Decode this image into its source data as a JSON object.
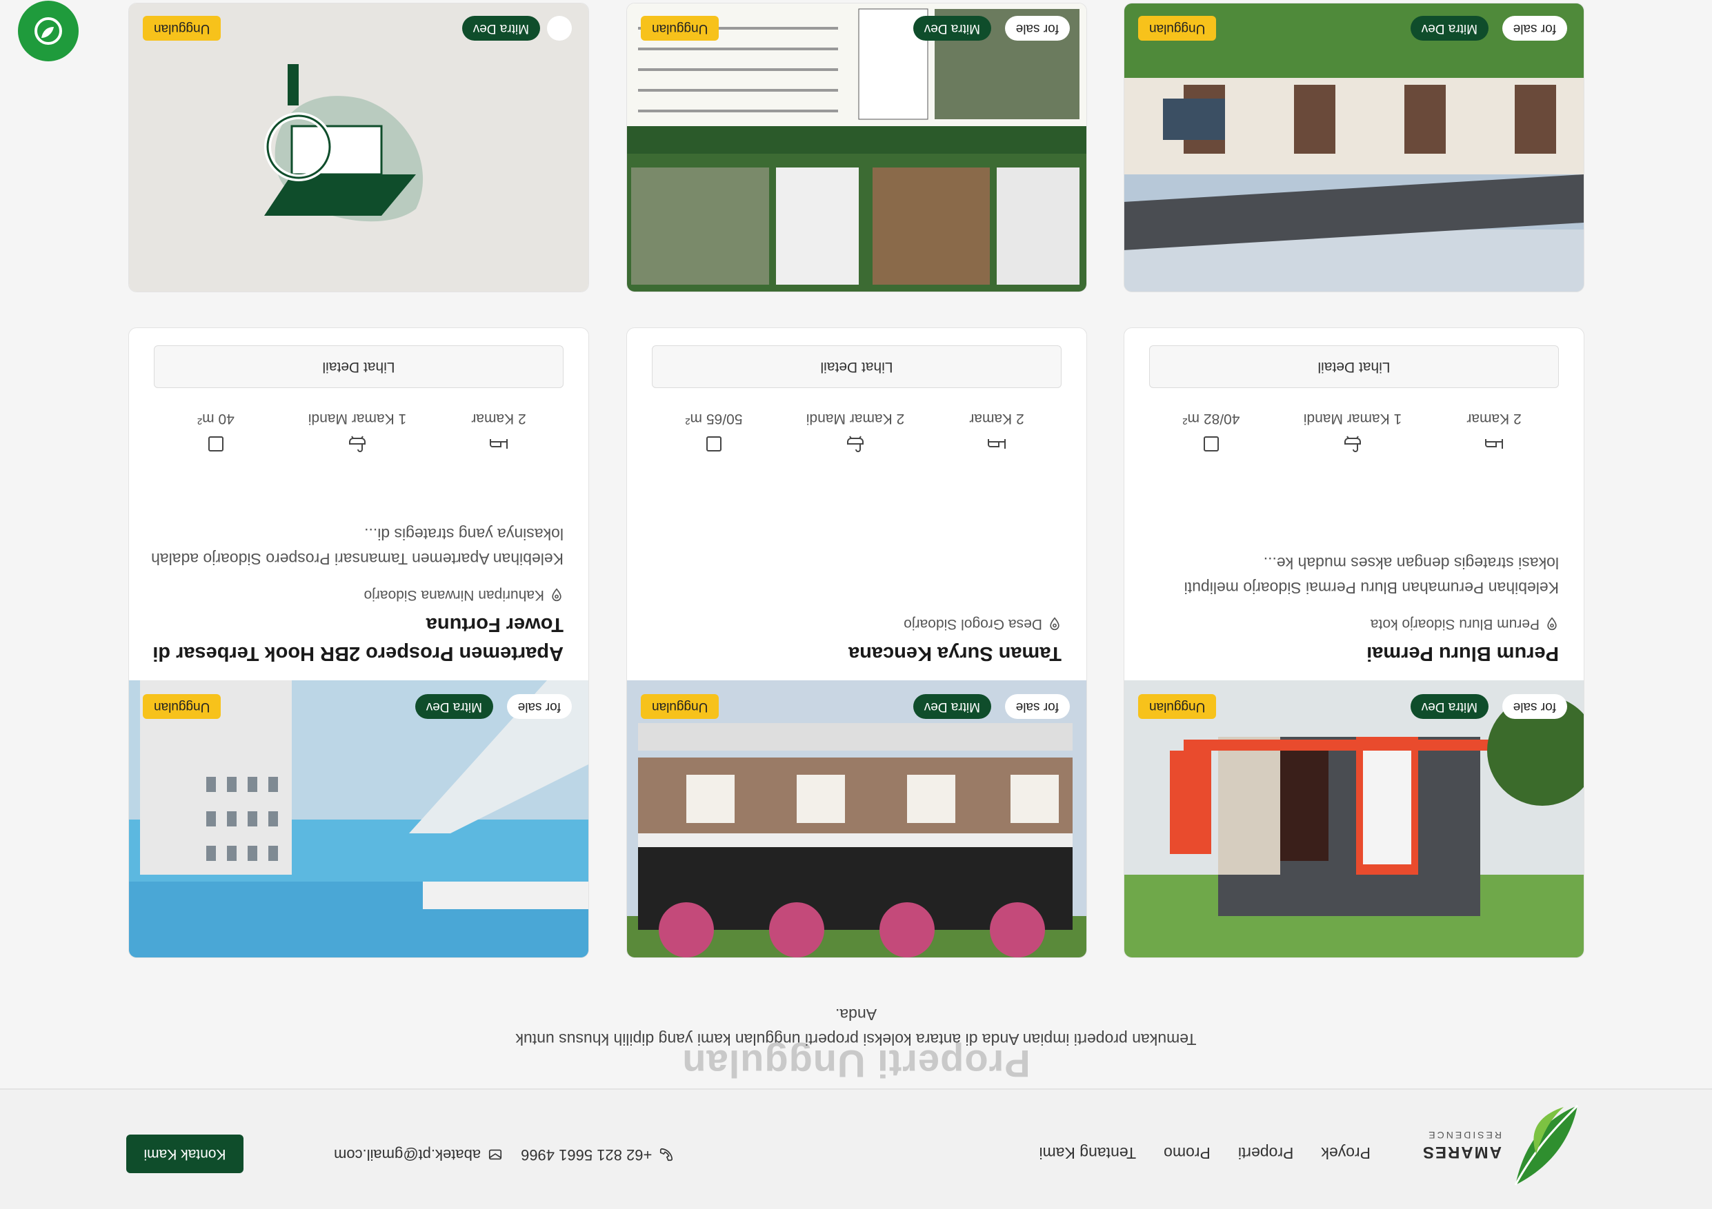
{
  "header": {
    "logo_name": "AMARES",
    "logo_sub": "RESIDENCE",
    "nav": [
      "Proyek",
      "Properti",
      "Promo",
      "Tentang Kami"
    ],
    "phone": "+62 821 5661 4966",
    "email": "abatek.pt@gmail.com",
    "contact_button": "Kontak Kami"
  },
  "section": {
    "title": "Properti Unggulan",
    "subtitle": "Temukan properti impian Anda di antara koleksi properti unggulan kami yang dipilih khusus untuk Anda."
  },
  "badges": {
    "sale": "for sale",
    "mitra": "Mitra Dev",
    "unggulan": "Unggulan"
  },
  "cards": [
    {
      "title": "Perum Bluru Permai",
      "location": "Perum Bluru Sidoarjo kota",
      "description": "Kelebihan Perumahan Bluru Permai Sidoarjo meliputi lokasi strategis dengan akses mudah ke...",
      "bedrooms": "2 Kamar",
      "bathrooms": "1 Kamar Mandi",
      "area": "40/82 m²",
      "button": "Lihat Detail"
    },
    {
      "title": "Taman Surya Kencana",
      "location": "Desa Grogol Sidoarjo",
      "description": "",
      "bedrooms": "2 Kamar",
      "bathrooms": "2 Kamar Mandi",
      "area": "50/65 m²",
      "button": "Lihat Detail"
    },
    {
      "title": "Apartemen Prospero 2BR Hook Terbesar di Tower Fortuna",
      "location": "Kahuripan Nirwana Sidoarjo",
      "description": "Kelebihan Apartemen Tamansari Prospero Sidoarjo adalah lokasinya yang strategis di...",
      "bedrooms": "2 Kamar",
      "bathrooms": "1 Kamar Mandi",
      "area": "40 m²",
      "button": "Lihat Detail"
    }
  ],
  "icons": {
    "fab": "leaf-chat-icon",
    "location": "map-pin-icon",
    "bed": "bed-icon",
    "bath": "bath-icon",
    "area": "area-square-icon",
    "phone": "phone-icon",
    "email": "mail-icon"
  },
  "colors": {
    "brand_green": "#0f4d2b",
    "accent_yellow": "#f7c21b",
    "fab_green": "#1f9b3c"
  }
}
